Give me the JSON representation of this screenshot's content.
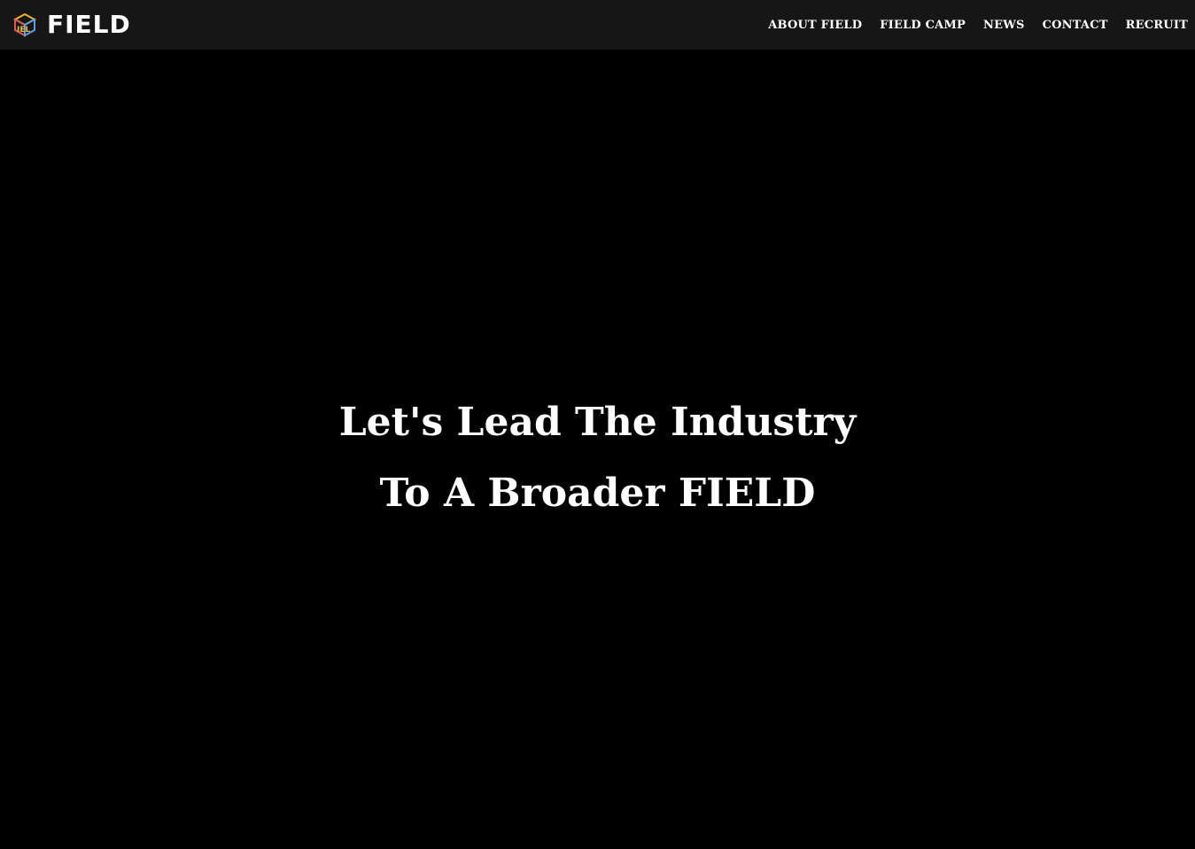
{
  "brand": {
    "name": "FIELD",
    "logo_icon": "cube-logo-icon",
    "logo_mark_letters": "IEL",
    "logo_colors": [
      "#f0b429",
      "#e05a4f",
      "#5aa0e0",
      "#6cc070"
    ]
  },
  "nav": {
    "items": [
      {
        "label": "ABOUT FIELD"
      },
      {
        "label": "FIELD CAMP"
      },
      {
        "label": "NEWS"
      },
      {
        "label": "CONTACT"
      },
      {
        "label": "RECRUIT"
      }
    ]
  },
  "hero": {
    "line1": "Let's Lead The Industry",
    "line2": "To A Broader FIELD"
  },
  "colors": {
    "header_bg": "#161616",
    "page_bg": "#000000",
    "text": "#ffffff"
  }
}
